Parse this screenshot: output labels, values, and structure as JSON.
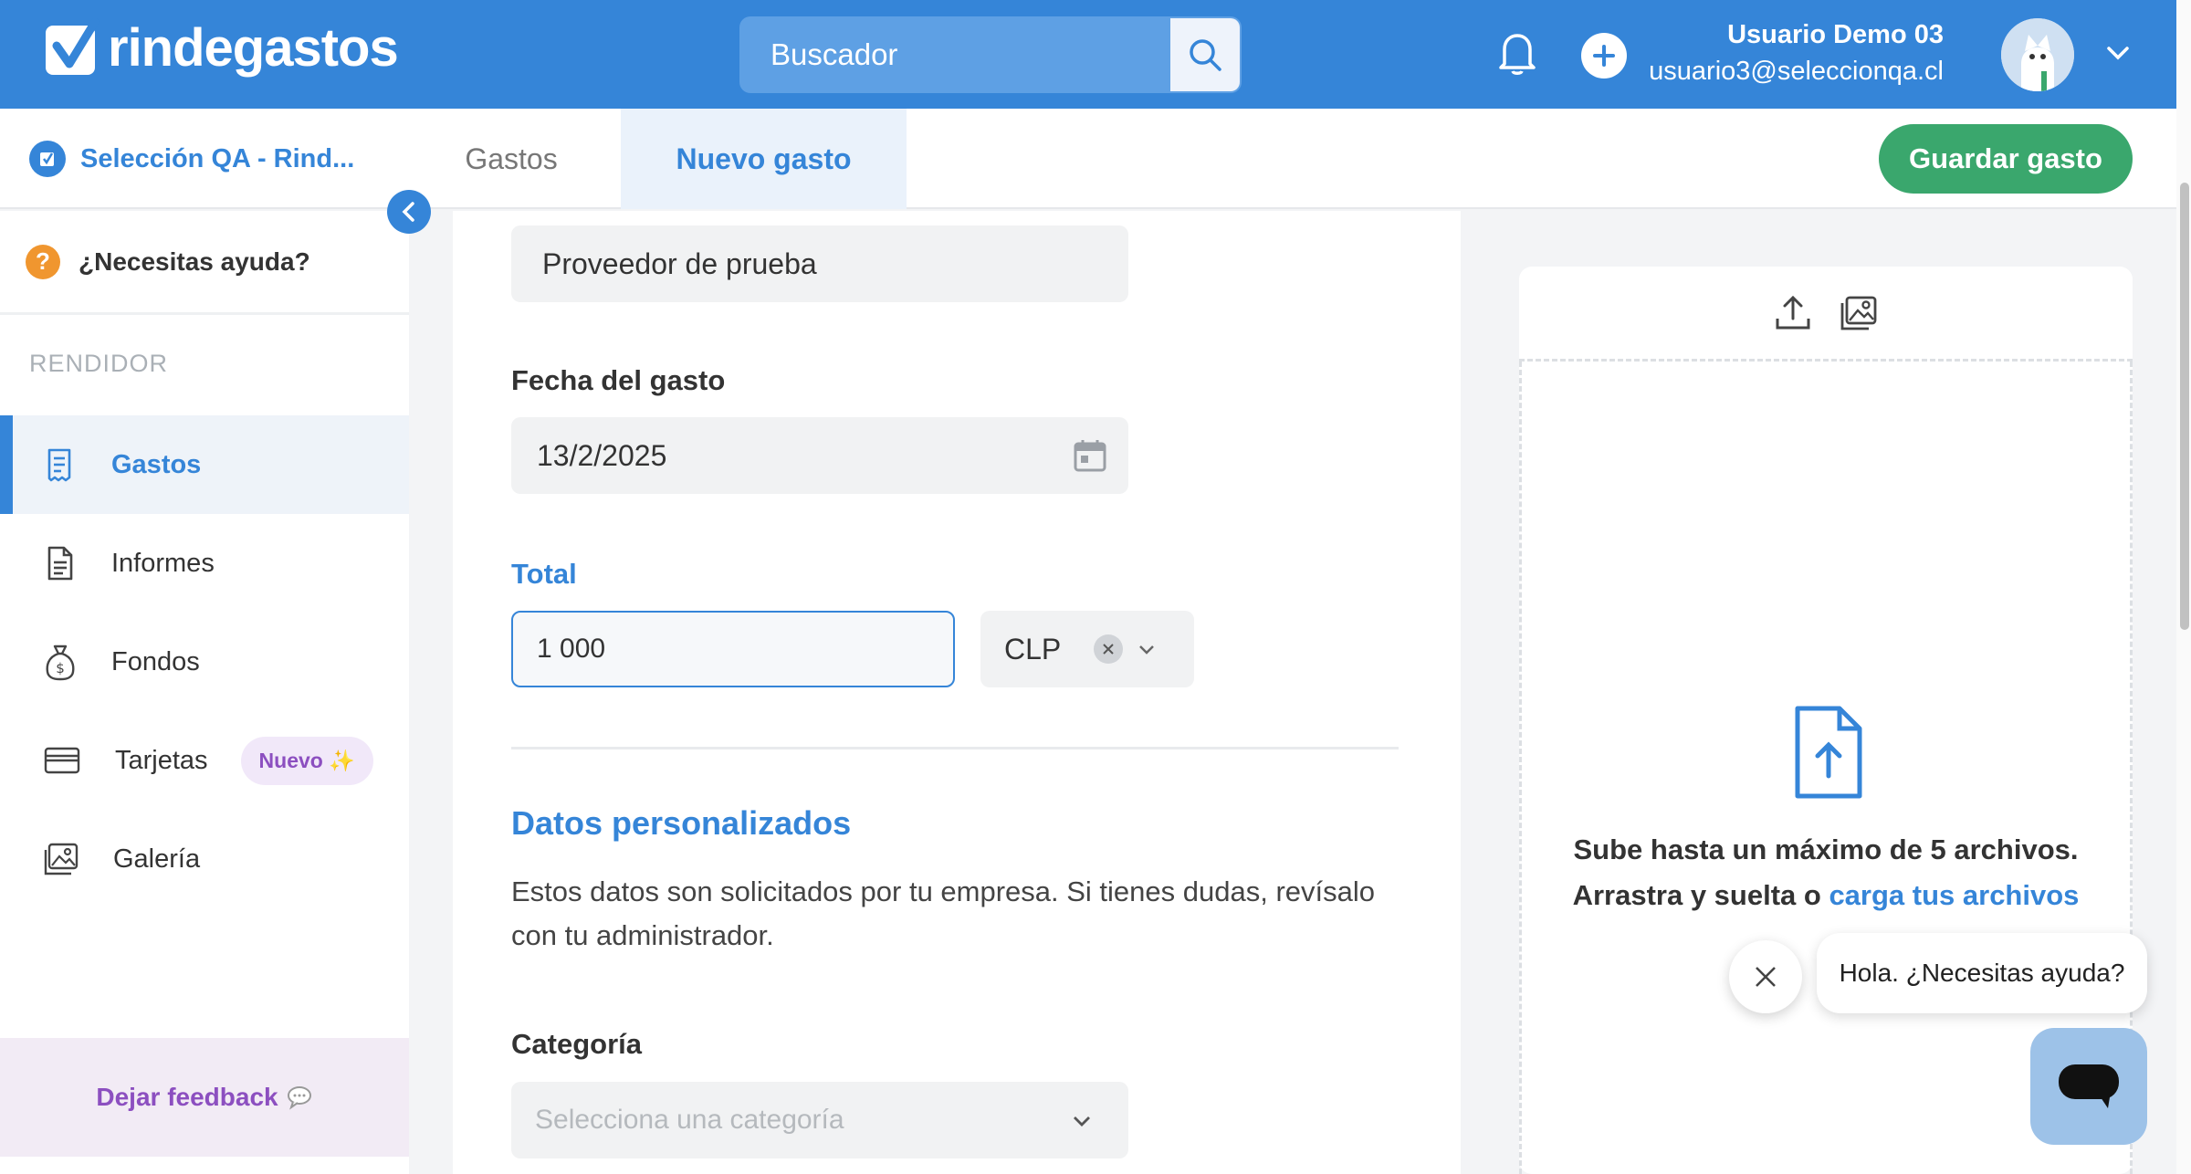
{
  "header": {
    "brand": "rindegastos",
    "search_placeholder": "Buscador",
    "user_name": "Usuario Demo 03",
    "user_email": "usuario3@seleccionqa.cl"
  },
  "subheader": {
    "company": "Selección QA - Rind...",
    "tabs": [
      {
        "label": "Gastos"
      },
      {
        "label": "Nuevo gasto"
      }
    ],
    "save_label": "Guardar gasto"
  },
  "sidebar": {
    "help": "¿Necesitas ayuda?",
    "section": "RENDIDOR",
    "items": [
      {
        "label": "Gastos",
        "icon": "receipt-icon"
      },
      {
        "label": "Informes",
        "icon": "document-icon"
      },
      {
        "label": "Fondos",
        "icon": "money-bag-icon"
      },
      {
        "label": "Tarjetas",
        "icon": "card-icon",
        "badge": "Nuevo"
      },
      {
        "label": "Galería",
        "icon": "gallery-icon"
      }
    ],
    "feedback": "Dejar feedback"
  },
  "form": {
    "provider_value": "Proveedor de prueba",
    "date_label": "Fecha del gasto",
    "date_value": "13/2/2025",
    "total_label": "Total",
    "total_value": "1 000",
    "currency": "CLP",
    "custom_title": "Datos personalizados",
    "custom_desc": "Estos datos son solicitados por tu empresa. Si tienes dudas, revísalo con tu administrador.",
    "category_label": "Categoría",
    "category_placeholder": "Selecciona una categoría"
  },
  "upload": {
    "line1": "Sube hasta un máximo de 5 archivos.",
    "line2_prefix": "Arrastra y suelta o",
    "line2_link": "carga tus archivos"
  },
  "chat": {
    "message": "Hola. ¿Necesitas ayuda?"
  },
  "colors": {
    "primary": "#3585d8",
    "save": "#3aa76d",
    "badge": "#8c4fc0"
  }
}
